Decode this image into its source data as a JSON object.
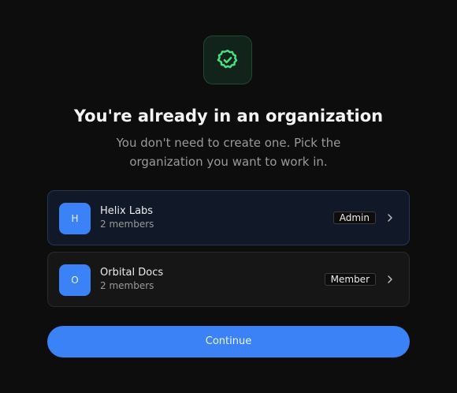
{
  "header": {
    "icon": "verified-badge-icon",
    "title": "You're already in an organization",
    "subtitle": "You don't need to create one. Pick the organization you want to work in."
  },
  "organizations": [
    {
      "initial": "H",
      "name": "Helix Labs",
      "members": "2 members",
      "role": "Admin",
      "selected": true
    },
    {
      "initial": "O",
      "name": "Orbital Docs",
      "members": "2 members",
      "role": "Member",
      "selected": false
    }
  ],
  "actions": {
    "continue_label": "Continue"
  },
  "colors": {
    "background": "#0d0d0d",
    "accent": "#3b82f6",
    "success": "#4ade80",
    "selected_border": "#233758"
  }
}
